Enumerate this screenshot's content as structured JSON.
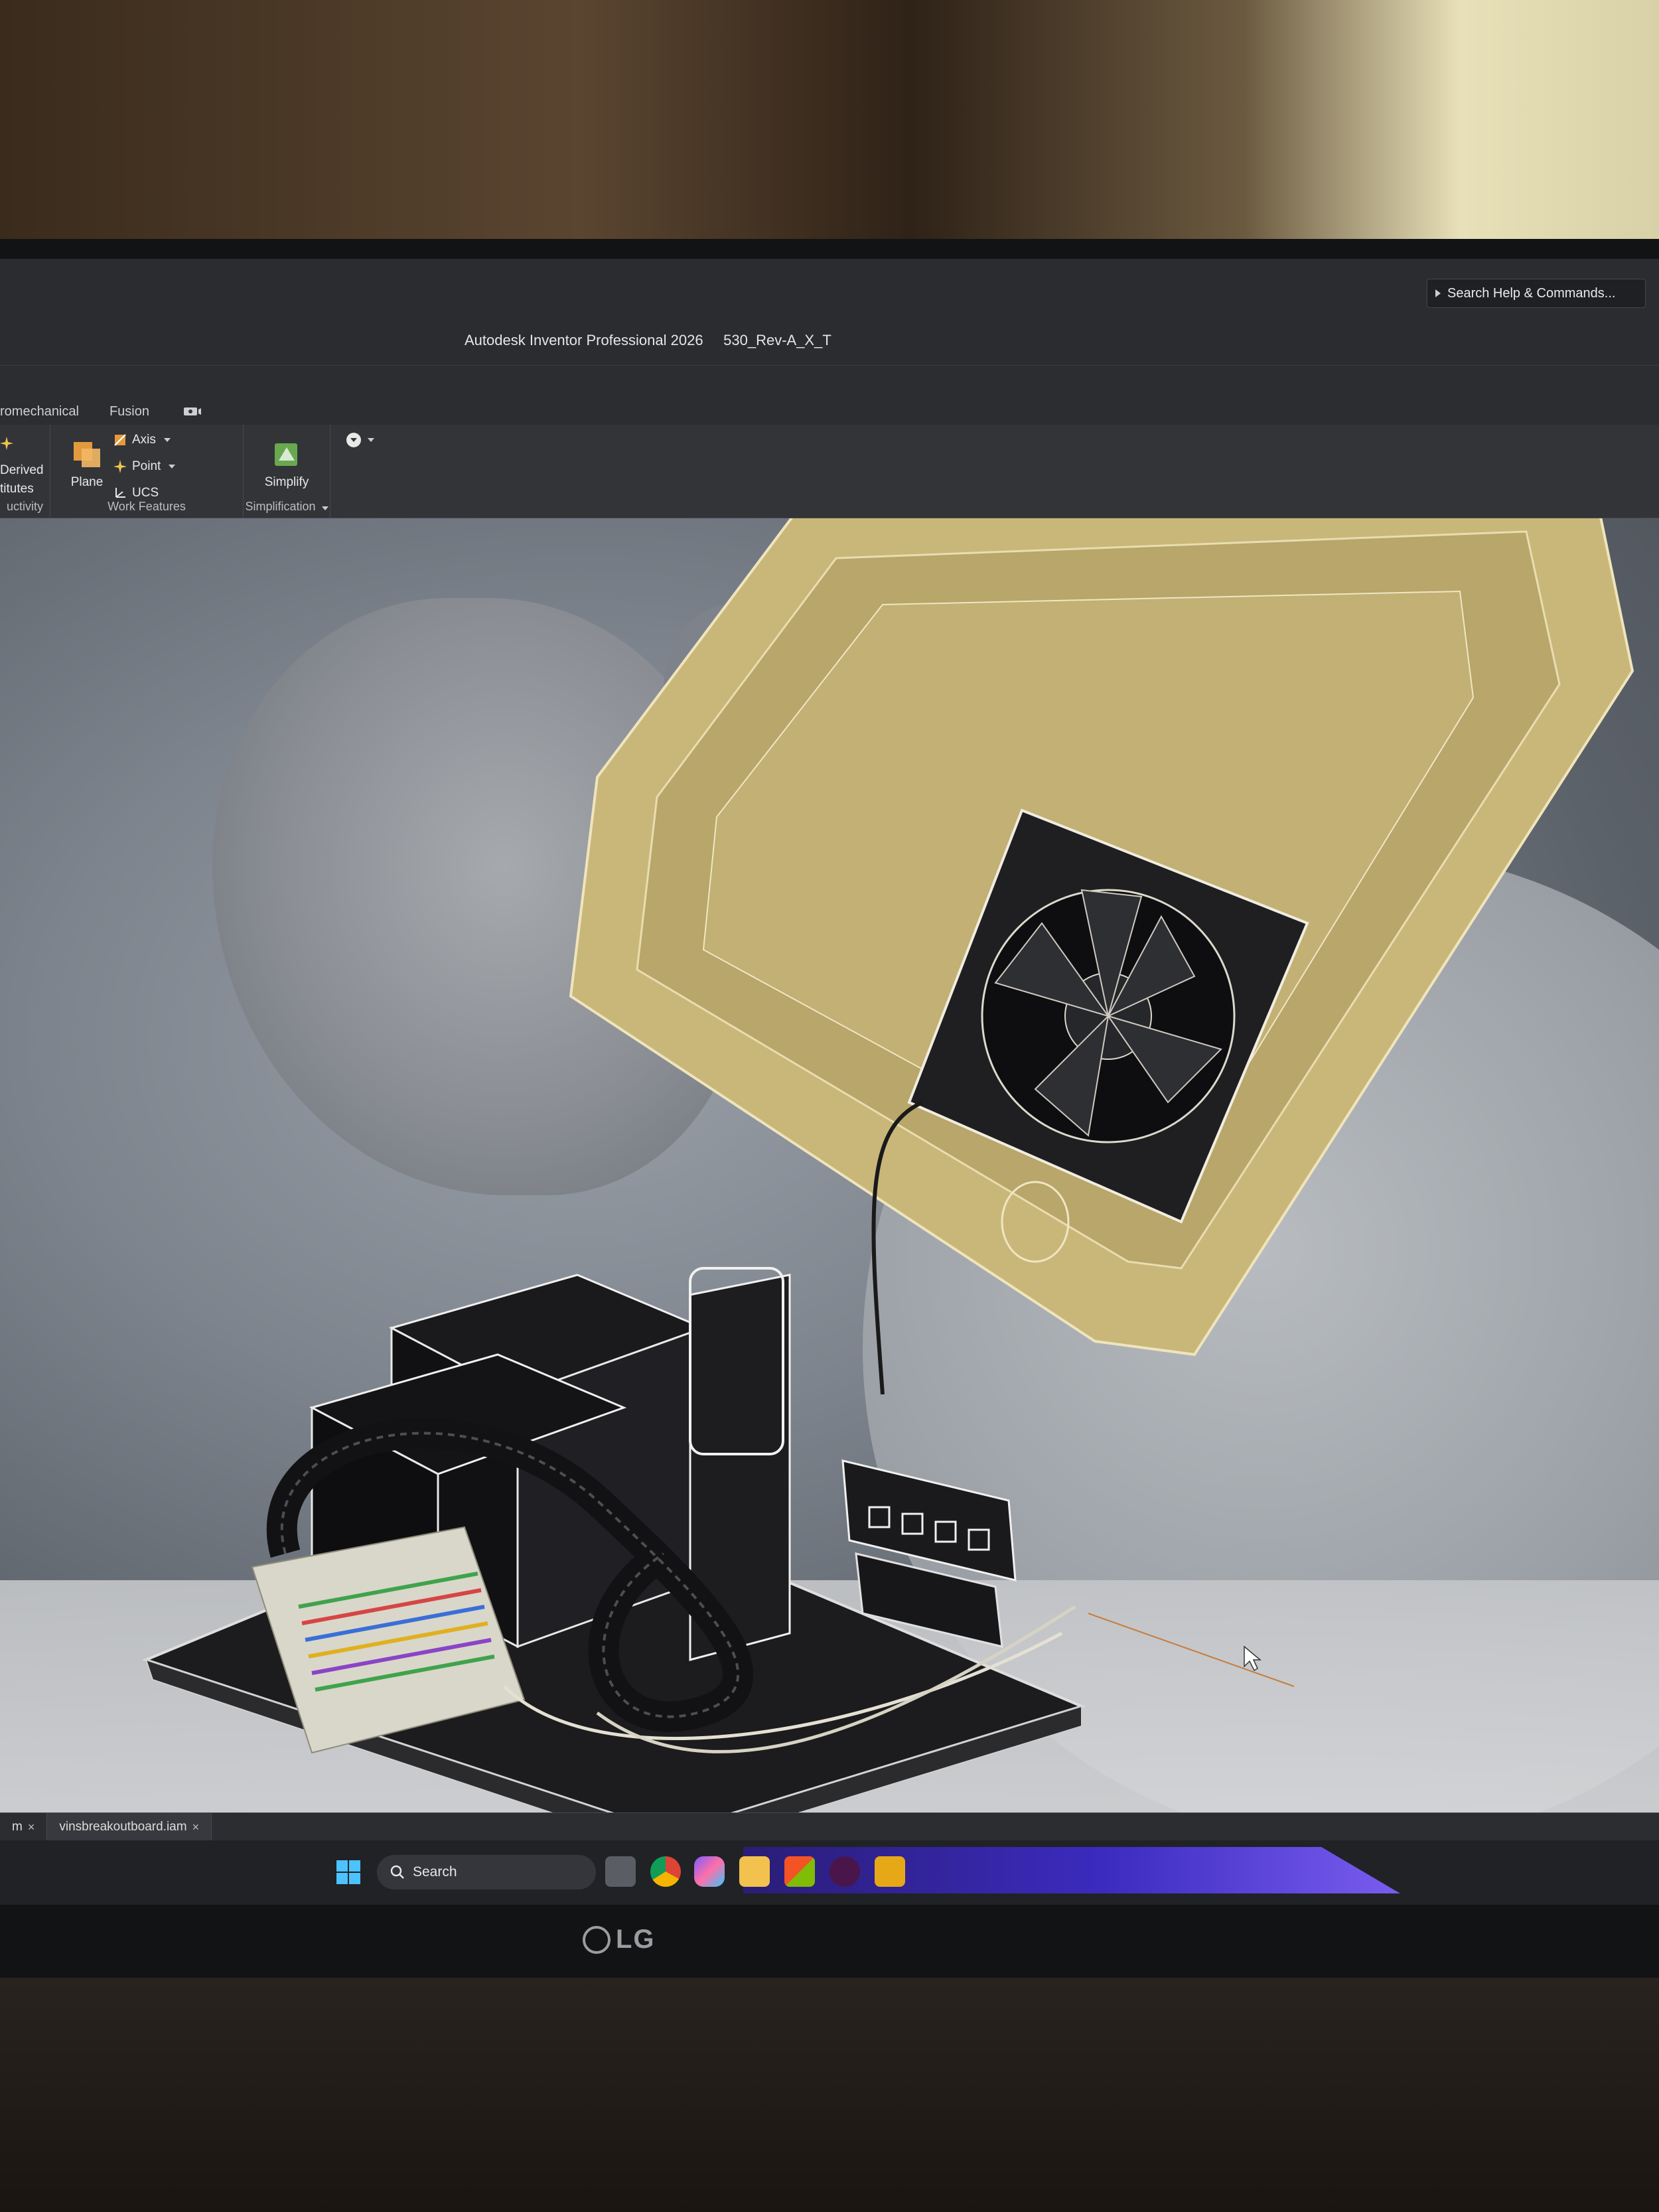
{
  "titlebar": {
    "title": "Autodesk Inventor Professional 2026",
    "document": "530_Rev-A_X_T",
    "search_placeholder": "Search Help & Commands..."
  },
  "ribbon": {
    "tabs": [
      "romechanical",
      "Fusion"
    ],
    "productivity_panel": {
      "label": "uctivity",
      "derived_label": "Derived",
      "substitutes_label": "titutes"
    },
    "work_features": {
      "label": "Work Features",
      "plane": "Plane",
      "axis": "Axis",
      "point": "Point",
      "ucs": "UCS"
    },
    "simplification": {
      "label": "Simplification",
      "simplify": "Simplify"
    }
  },
  "document_tabs": [
    {
      "label": "m",
      "active": false
    },
    {
      "label": "vinsbreakoutboard.iam",
      "active": true
    }
  ],
  "taskbar": {
    "search_label": "Search",
    "icons": [
      "task-view-icon",
      "chrome-icon",
      "copilot-icon",
      "file-explorer-icon",
      "microsoft-store-icon",
      "slack-icon",
      "inventor-icon"
    ]
  },
  "monitor": {
    "brand": "LG"
  },
  "colors": {
    "ribbon_bg": "#323438",
    "viewport_gold": "#c9b77a",
    "cad_dark": "#1c1c1e",
    "taskbar_accent": "#3b2bbf"
  }
}
